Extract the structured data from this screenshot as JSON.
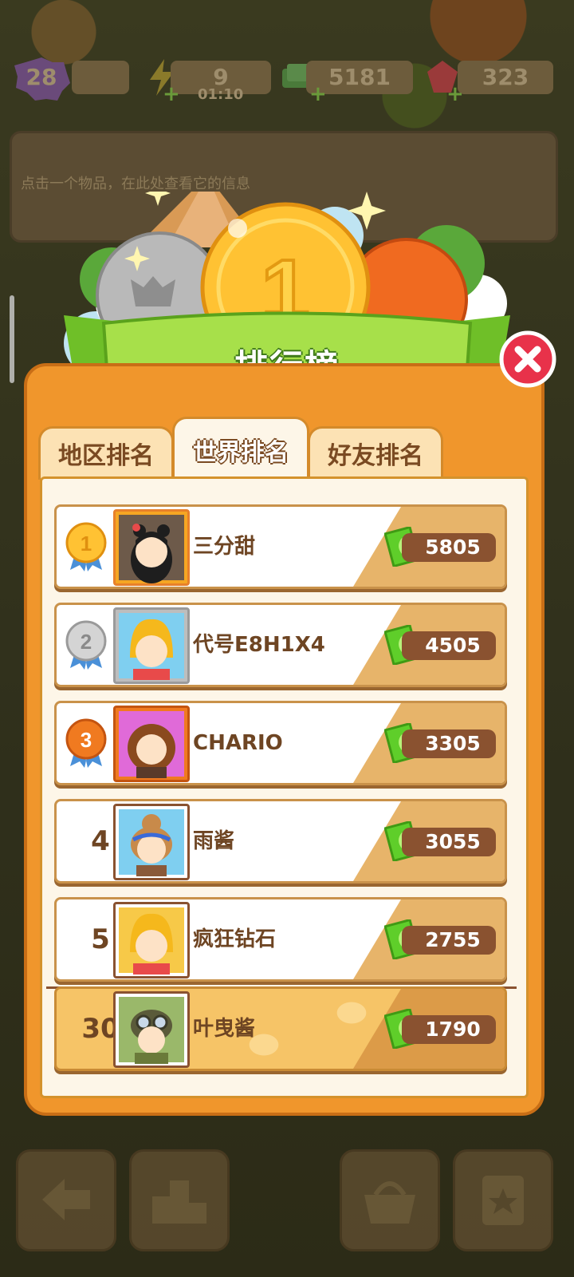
{
  "top_bar": {
    "level": "28",
    "energy": "9",
    "energy_timer": "01:10",
    "cash": "5181",
    "gems": "323"
  },
  "info_hint": "点击一个物品，在此处查看它的信息",
  "leaderboard": {
    "title": "排行榜",
    "tabs": [
      {
        "label": "地区排名",
        "active": false
      },
      {
        "label": "世界排名",
        "active": true
      },
      {
        "label": "好友排名",
        "active": false
      }
    ],
    "entries": [
      {
        "rank": "1",
        "name": "三分甜",
        "score": "5805"
      },
      {
        "rank": "2",
        "name": "代号E8H1X4",
        "score": "4505"
      },
      {
        "rank": "3",
        "name": "CHARIO",
        "score": "3305"
      },
      {
        "rank": "4",
        "name": "雨酱",
        "score": "3055"
      },
      {
        "rank": "5",
        "name": "疯狂钻石",
        "score": "2755"
      }
    ],
    "me": {
      "rank": "30",
      "name": "叶曳酱",
      "score": "1790"
    }
  },
  "colors": {
    "panel": "#f0962c",
    "panel_border": "#c86e16",
    "banner_green": "#9ad83a",
    "score_pill": "#8a5230",
    "close_red": "#e8324a"
  },
  "icons": [
    "level-badge-icon",
    "energy-icon",
    "cash-icon",
    "gem-icon",
    "close-icon",
    "gold-medal-icon",
    "silver-medal-icon",
    "bronze-medal-icon",
    "ticket-icon",
    "back-icon",
    "podium-icon",
    "basket-icon",
    "clipboard-icon"
  ]
}
